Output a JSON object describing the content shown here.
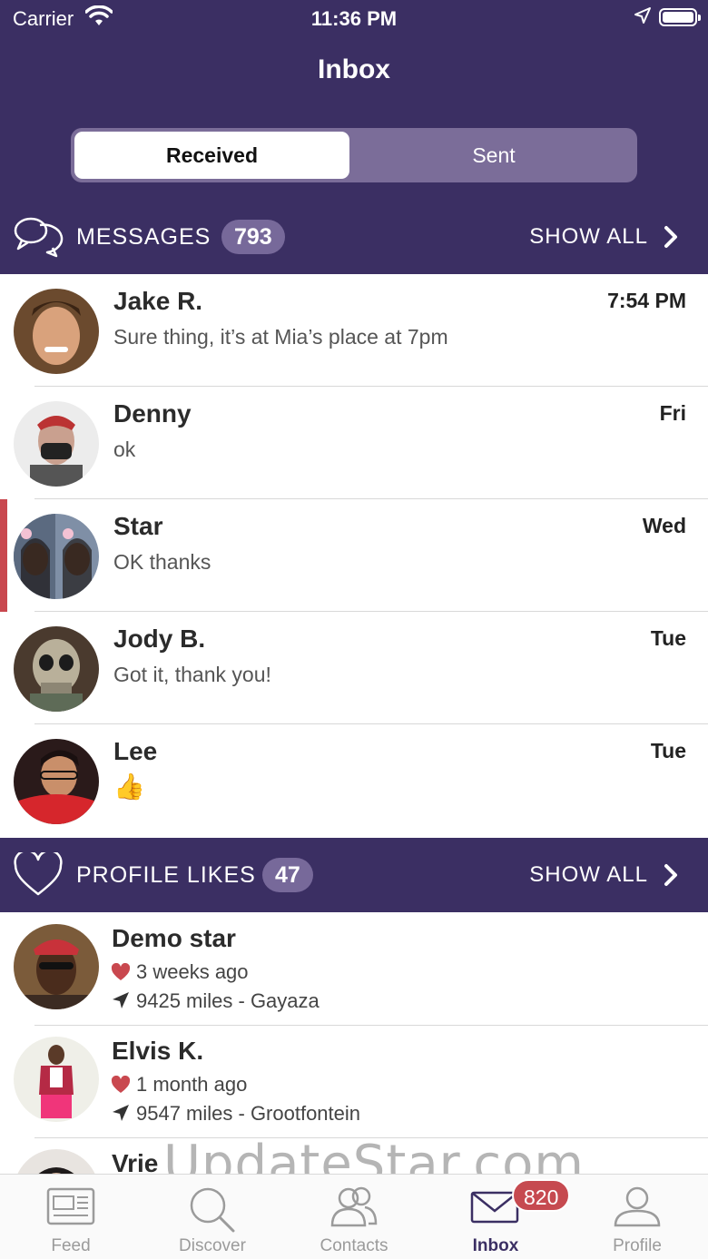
{
  "status_bar": {
    "carrier": "Carrier",
    "time": "11:36 PM"
  },
  "header": {
    "title": "Inbox"
  },
  "segment": {
    "received_label": "Received",
    "sent_label": "Sent",
    "selected": "Received"
  },
  "messages_section": {
    "label": "MESSAGES",
    "count": "793",
    "show_all": "SHOW ALL"
  },
  "messages": [
    {
      "name": "Jake R.",
      "preview": "Sure thing, it’s at Mia’s place at 7pm",
      "time": "7:54 PM"
    },
    {
      "name": "Denny",
      "preview": "ok",
      "time": "Fri"
    },
    {
      "name": "Star",
      "preview": "OK thanks",
      "time": "Wed",
      "unread": true
    },
    {
      "name": "Jody B.",
      "preview": "Got it, thank you!",
      "time": "Tue"
    },
    {
      "name": "Lee",
      "preview": "👍",
      "time": "Tue"
    }
  ],
  "likes_section": {
    "label": "PROFILE LIKES",
    "count": "47",
    "show_all": "SHOW ALL"
  },
  "likes": [
    {
      "name": "Demo star",
      "liked": "3 weeks ago",
      "distance": "9425 miles - Gayaza"
    },
    {
      "name": "Elvis K.",
      "liked": "1 month ago",
      "distance": "9547 miles - Grootfontein"
    },
    {
      "name": "Vrie"
    }
  ],
  "watermark": "UpdateStar.com",
  "tabbar": {
    "feed": "Feed",
    "discover": "Discover",
    "contacts": "Contacts",
    "inbox": "Inbox",
    "profile": "Profile",
    "inbox_badge": "820",
    "active": "Inbox"
  },
  "colors": {
    "header_bg": "#3b2f63",
    "badge": "#c64a50",
    "unread_bar": "#c9484f",
    "heart": "#c9484f"
  }
}
